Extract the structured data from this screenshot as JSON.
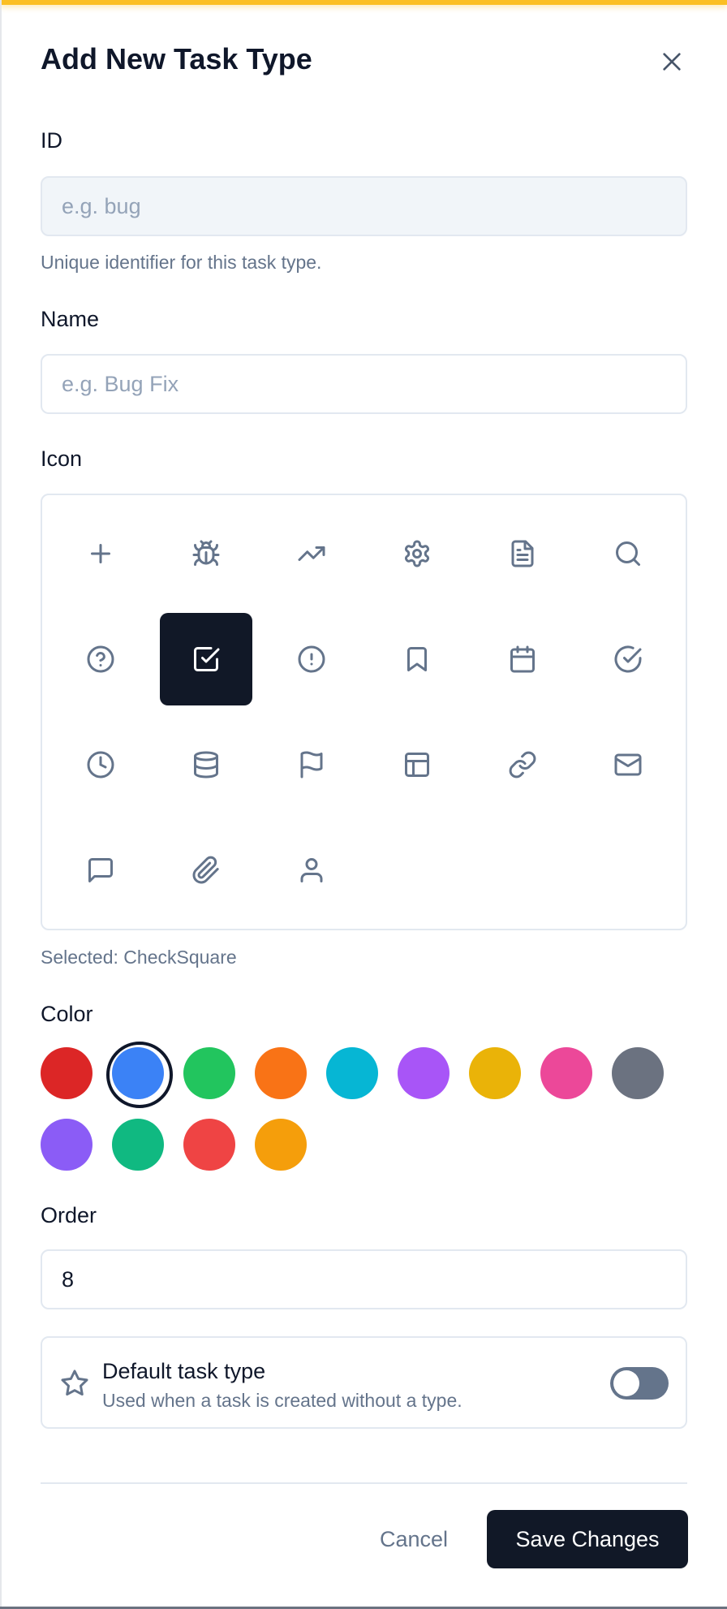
{
  "dialog": {
    "title": "Add New Task Type",
    "close_icon": "close-icon"
  },
  "fields": {
    "id": {
      "label": "ID",
      "value": "",
      "placeholder": "e.g. bug",
      "hint": "Unique identifier for this task type."
    },
    "name": {
      "label": "Name",
      "value": "",
      "placeholder": "e.g. Bug Fix"
    },
    "icon": {
      "label": "Icon",
      "selected_text": "Selected: CheckSquare",
      "selected": "CheckSquare",
      "options": [
        "plus-icon",
        "bug-icon",
        "trending-up-icon",
        "settings-icon",
        "file-text-icon",
        "search-icon",
        "help-circle-icon",
        "check-square-icon",
        "alert-circle-icon",
        "bookmark-icon",
        "calendar-icon",
        "check-circle-icon",
        "clock-icon",
        "database-icon",
        "flag-icon",
        "layout-icon",
        "link-icon",
        "mail-icon",
        "message-square-icon",
        "paperclip-icon",
        "user-icon"
      ]
    },
    "color": {
      "label": "Color",
      "selected": "#3b82f6",
      "options": [
        "#dc2626",
        "#3b82f6",
        "#22c55e",
        "#f97316",
        "#06b6d4",
        "#a855f7",
        "#eab308",
        "#ec4899",
        "#6b7280",
        "#8b5cf6",
        "#10b981",
        "#ef4444",
        "#f59e0b"
      ]
    },
    "order": {
      "label": "Order",
      "value": "8"
    },
    "default_type": {
      "icon": "star-icon",
      "title": "Default task type",
      "description": "Used when a task is created without a type.",
      "enabled": false
    }
  },
  "footer": {
    "cancel_label": "Cancel",
    "save_label": "Save Changes"
  },
  "colors": {
    "accent_bar": "#fbbf24",
    "primary": "#111827",
    "muted_text": "#64748b"
  }
}
